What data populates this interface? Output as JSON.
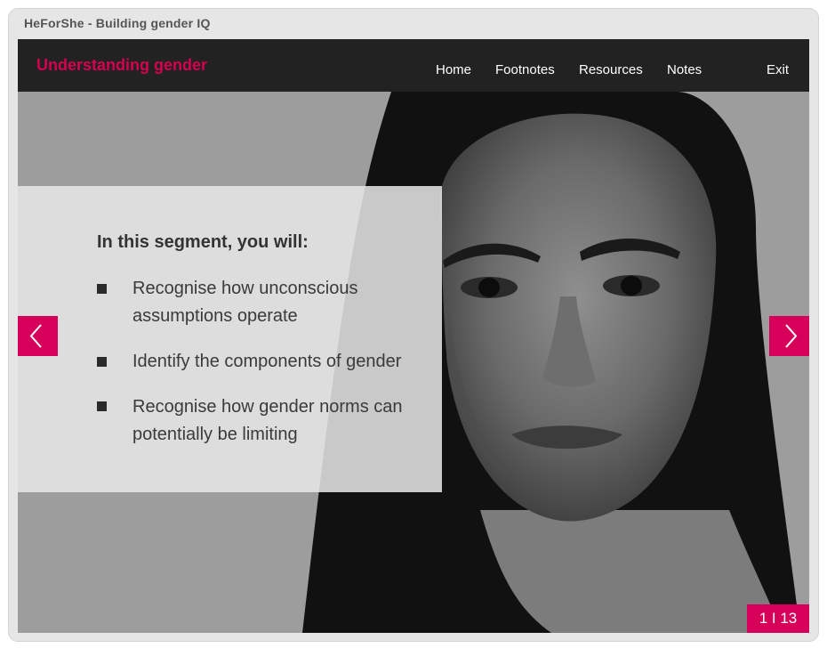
{
  "window": {
    "title": "HeForShe - Building gender IQ"
  },
  "header": {
    "course_title": "Understanding gender",
    "nav": {
      "home": "Home",
      "footnotes": "Footnotes",
      "resources": "Resources",
      "notes": "Notes",
      "exit": "Exit"
    }
  },
  "panel": {
    "heading": "In this segment, you will:",
    "items": [
      "Recognise how unconscious assumptions operate",
      "Identify the components of gender",
      "Recognise how gender norms can potentially be limiting"
    ]
  },
  "navigation": {
    "prev_icon": "chevron-left-icon",
    "next_icon": "chevron-right-icon"
  },
  "pager": {
    "label": "1 I 13"
  },
  "colors": {
    "accent": "#d6005a",
    "topbar": "#222222",
    "title": "#d6004f"
  },
  "image": {
    "subject": "grayscale portrait photo"
  }
}
